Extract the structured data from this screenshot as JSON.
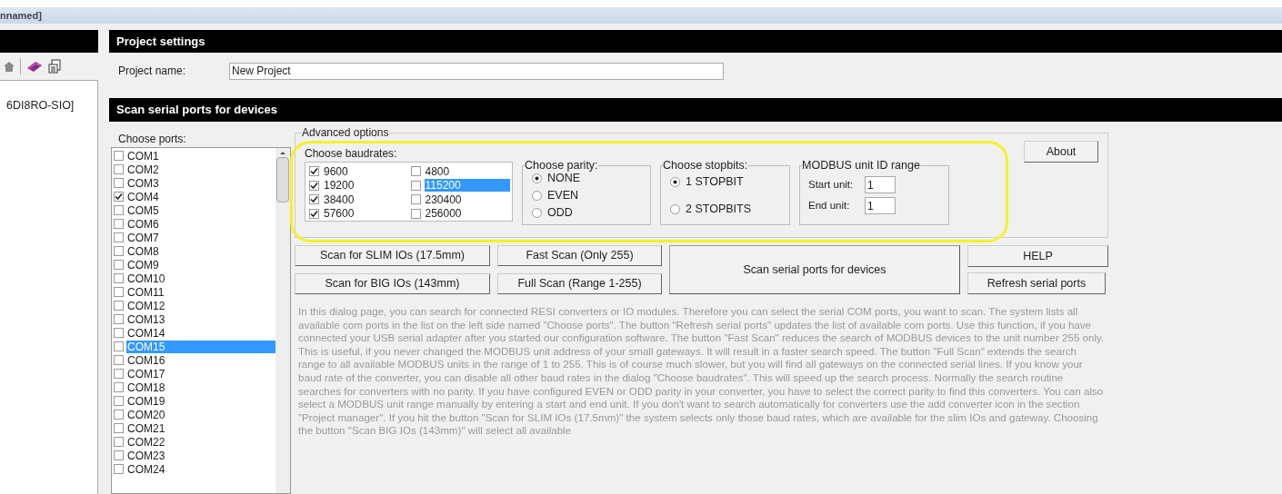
{
  "window": {
    "title": "nnamed]"
  },
  "project_manager": {
    "tree_items": [
      "6DI8RO-SIO]"
    ]
  },
  "project_settings": {
    "title": "Project settings",
    "project_name_label": "Project name:",
    "project_name": "New Project"
  },
  "scan": {
    "title": "Scan serial ports for devices",
    "ports_label": "Choose ports:",
    "ports": [
      {
        "label": "COM1",
        "checked": false,
        "selected": false
      },
      {
        "label": "COM2",
        "checked": false,
        "selected": false
      },
      {
        "label": "COM3",
        "checked": false,
        "selected": false
      },
      {
        "label": "COM4",
        "checked": true,
        "selected": false
      },
      {
        "label": "COM5",
        "checked": false,
        "selected": false
      },
      {
        "label": "COM6",
        "checked": false,
        "selected": false
      },
      {
        "label": "COM7",
        "checked": false,
        "selected": false
      },
      {
        "label": "COM8",
        "checked": false,
        "selected": false
      },
      {
        "label": "COM9",
        "checked": false,
        "selected": false
      },
      {
        "label": "COM10",
        "checked": false,
        "selected": false
      },
      {
        "label": "COM11",
        "checked": false,
        "selected": false
      },
      {
        "label": "COM12",
        "checked": false,
        "selected": false
      },
      {
        "label": "COM13",
        "checked": false,
        "selected": false
      },
      {
        "label": "COM14",
        "checked": false,
        "selected": false
      },
      {
        "label": "COM15",
        "checked": false,
        "selected": true
      },
      {
        "label": "COM16",
        "checked": false,
        "selected": false
      },
      {
        "label": "COM17",
        "checked": false,
        "selected": false
      },
      {
        "label": "COM18",
        "checked": false,
        "selected": false
      },
      {
        "label": "COM19",
        "checked": false,
        "selected": false
      },
      {
        "label": "COM20",
        "checked": false,
        "selected": false
      },
      {
        "label": "COM21",
        "checked": false,
        "selected": false
      },
      {
        "label": "COM22",
        "checked": false,
        "selected": false
      },
      {
        "label": "COM23",
        "checked": false,
        "selected": false
      },
      {
        "label": "COM24",
        "checked": false,
        "selected": false
      }
    ],
    "advanced": {
      "title": "Advanced options",
      "baudrates_label": "Choose baudrates:",
      "baudrates": [
        {
          "label": "9600",
          "checked": true,
          "selected": false
        },
        {
          "label": "19200",
          "checked": true,
          "selected": false
        },
        {
          "label": "38400",
          "checked": true,
          "selected": false
        },
        {
          "label": "57600",
          "checked": true,
          "selected": false
        },
        {
          "label": "4800",
          "checked": false,
          "selected": false
        },
        {
          "label": "115200",
          "checked": false,
          "selected": true
        },
        {
          "label": "230400",
          "checked": false,
          "selected": false
        },
        {
          "label": "256000",
          "checked": false,
          "selected": false
        }
      ],
      "parity": {
        "title": "Choose parity:",
        "options": [
          {
            "label": "NONE",
            "selected": true
          },
          {
            "label": "EVEN",
            "selected": false
          },
          {
            "label": "ODD",
            "selected": false
          }
        ]
      },
      "stopbits": {
        "title": "Choose stopbits:",
        "options": [
          {
            "label": "1 STOPBIT",
            "selected": true
          },
          {
            "label": "2 STOPBITS",
            "selected": false
          }
        ]
      },
      "unit_range": {
        "title": "MODBUS unit ID range",
        "start_label": "Start unit:",
        "start": "1",
        "end_label": "End unit:",
        "end": "1"
      },
      "about_button": "About"
    },
    "buttons": {
      "slim": "Scan for SLIM IOs (17.5mm)",
      "big": "Scan for BIG IOs (143mm)",
      "fast": "Fast Scan (Only 255)",
      "full": "Full Scan (Range 1-255)",
      "scan": "Scan serial ports for devices",
      "help": "HELP",
      "refresh": "Refresh serial ports"
    },
    "description": "In this dialog page, you can search for connected RESI converters or IO modules. Therefore you can select the serial COM ports, you want to scan. The system lists all available com ports in the list on the left side named \"Choose ports\". The button \"Refresh serial ports\" updates the list of available com ports. Use this function, if you have connected your USB serial adapter after you started our configuration software. The button \"Fast Scan\" reduces the search of MODBUS devices to the unit number 255 only. This is useful, if you never changed the MODBUS unit address of your small gateways. It will result in a faster search speed. The button \"Full Scan\" extends the search range to all available MODBUS units in the range of 1 to 255. This is of course much slower, but you will find all gateways on the connected serial lines. If you know your baud rate of the converter, you can disable all other baud rates in the dialog \"Choose baudrates\". This will speed up the search process. Normally the search routine searches for converters with no parity. If you have configured EVEN or ODD parity in your converter, you have to select the correct parity to find this converters. You can also select a MODBUS unit range manually by entering a start and end unit. If you don't want to search automatically for converters use the add converter icon in the section \"Project manager\". If you hit the button \"Scan for SLIM IOs (17.5mm)\" the system selects only those baud rates, which are available for the slim IOs and gateway. Choosing the button \"Scan BIG IOs (143mm)\" will select all available"
  }
}
